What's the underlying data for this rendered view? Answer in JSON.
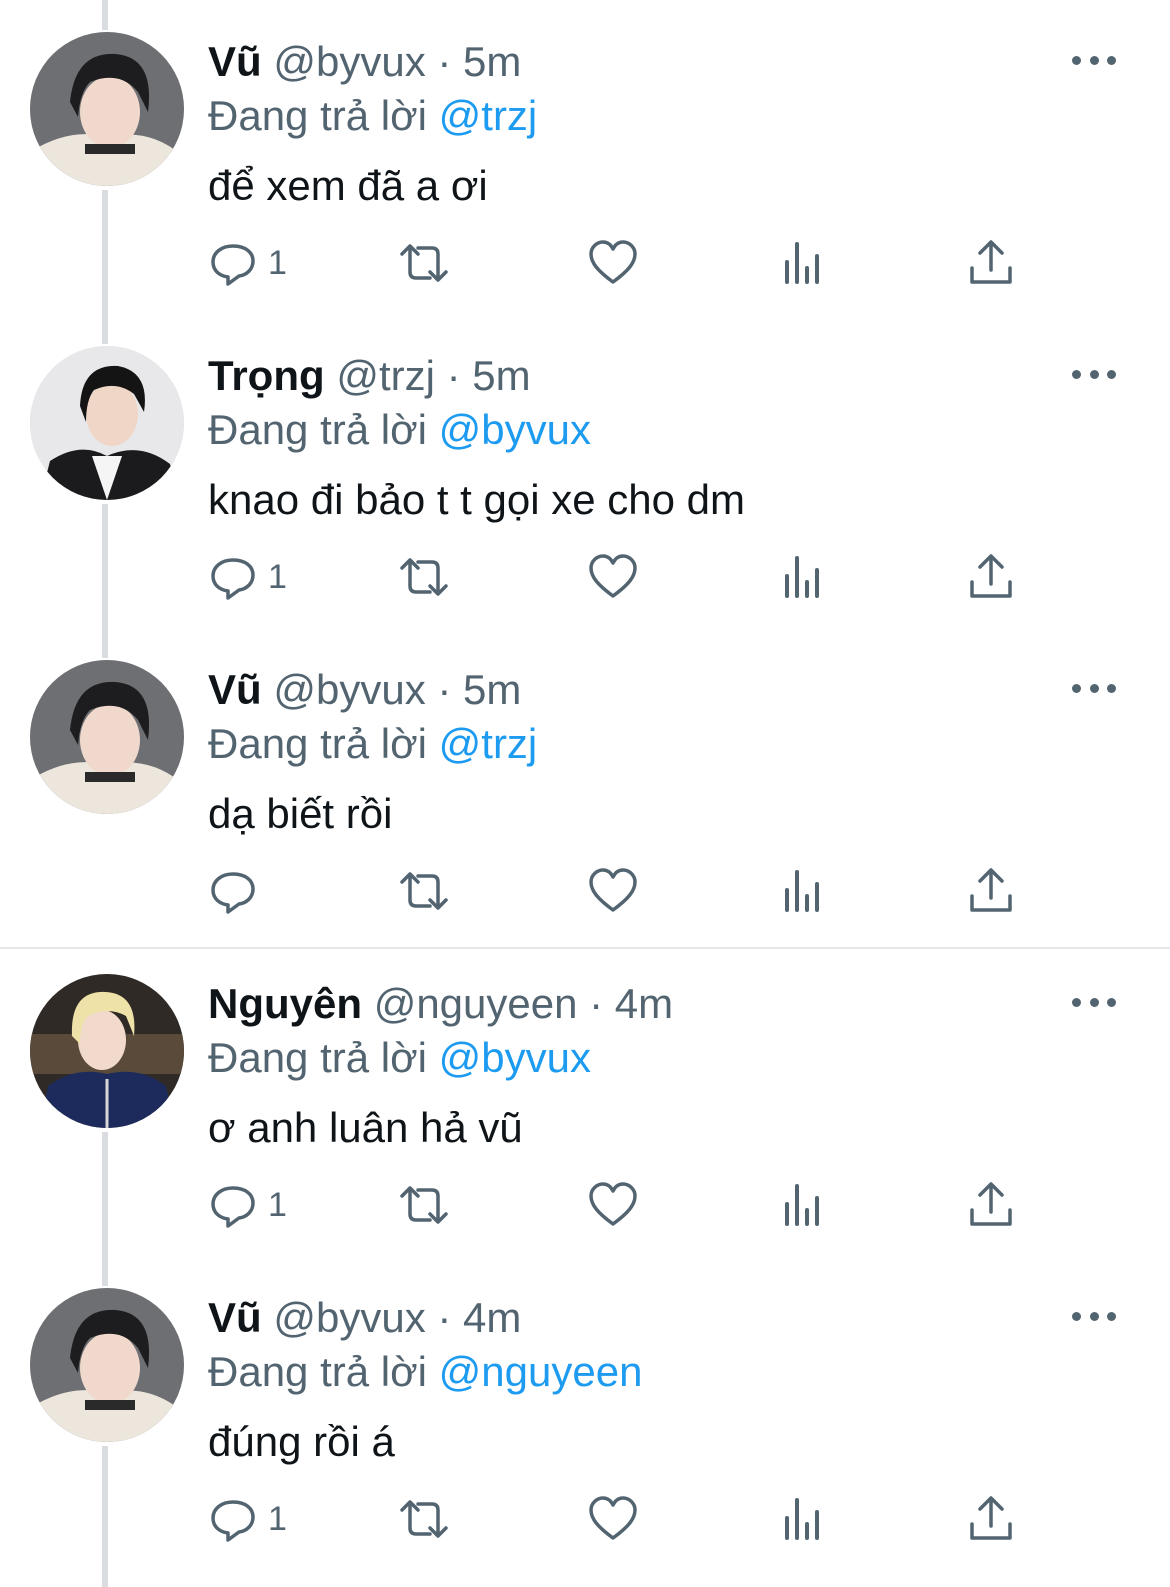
{
  "reply_prefix": "Đang trả lời",
  "colors": {
    "text": "#0f1419",
    "secondary": "#536471",
    "link": "#1d9bf0",
    "thread_line": "#d9dce0"
  },
  "tweets": [
    {
      "name": "Vũ",
      "handle": "@byvux",
      "time": "· 5m",
      "replying_to": "@trzj",
      "text": "để xem đã a ơi",
      "replies": "1",
      "avatar": "dark-hair-boy-avatar"
    },
    {
      "name": "Trọng",
      "handle": "@trzj",
      "time": "· 5m",
      "replying_to": "@byvux",
      "text": "knao đi bảo t t gọi xe cho dm",
      "replies": "1",
      "avatar": "black-jacket-boy-avatar"
    },
    {
      "name": "Vũ",
      "handle": "@byvux",
      "time": "· 5m",
      "replying_to": "@trzj",
      "text": "dạ biết rồi",
      "replies": "",
      "avatar": "dark-hair-boy-avatar"
    },
    {
      "name": "Nguyên",
      "handle": "@nguyeen",
      "time": "· 4m",
      "replying_to": "@byvux",
      "text": "ơ anh luân hả vũ",
      "replies": "1",
      "avatar": "blond-boy-avatar"
    },
    {
      "name": "Vũ",
      "handle": "@byvux",
      "time": "· 4m",
      "replying_to": "@nguyeen",
      "text": "đúng rồi á",
      "replies": "1",
      "avatar": "dark-hair-boy-avatar"
    }
  ]
}
